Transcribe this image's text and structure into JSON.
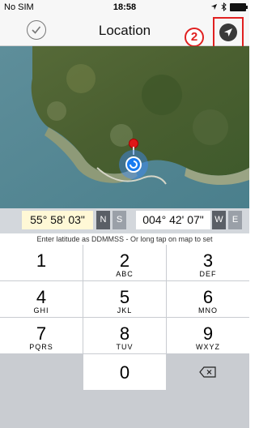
{
  "status_bar": {
    "carrier": "No SIM",
    "time": "18:58",
    "icons": [
      "location-arrow-icon",
      "bluetooth-icon",
      "battery-icon"
    ]
  },
  "nav": {
    "title": "Location",
    "done_icon": "checkmark-circle-icon",
    "locate_icon": "location-arrow-icon",
    "callout_number": "2"
  },
  "coords": {
    "latitude": "55° 58' 03\"",
    "lat_hemispheres": [
      "N",
      "S"
    ],
    "lat_selected": "N",
    "longitude": "004° 42' 07\"",
    "lon_hemispheres": [
      "W",
      "E"
    ],
    "lon_selected": "W",
    "hint": "Enter latitude as DDMMSS - Or long tap on map to set"
  },
  "keypad": [
    {
      "digit": "1",
      "letters": ""
    },
    {
      "digit": "2",
      "letters": "ABC"
    },
    {
      "digit": "3",
      "letters": "DEF"
    },
    {
      "digit": "4",
      "letters": "GHI"
    },
    {
      "digit": "5",
      "letters": "JKL"
    },
    {
      "digit": "6",
      "letters": "MNO"
    },
    {
      "digit": "7",
      "letters": "PQRS"
    },
    {
      "digit": "8",
      "letters": "TUV"
    },
    {
      "digit": "9",
      "letters": "WXYZ"
    },
    {
      "digit": "0",
      "letters": ""
    }
  ],
  "colors": {
    "accent": "#e02020",
    "user_location": "#1a7cf0",
    "pin": "#e01818"
  }
}
